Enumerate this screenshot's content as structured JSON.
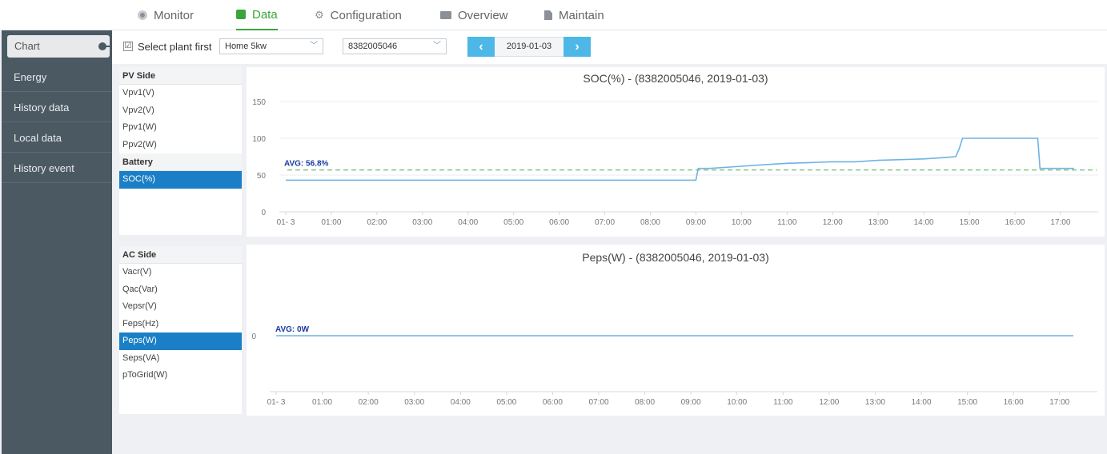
{
  "nav": {
    "tabs": [
      {
        "label": "Monitor",
        "icon": "monitor-icon"
      },
      {
        "label": "Data",
        "icon": "data-icon",
        "active": true
      },
      {
        "label": "Configuration",
        "icon": "configuration-icon"
      },
      {
        "label": "Overview",
        "icon": "overview-icon"
      },
      {
        "label": "Maintain",
        "icon": "maintain-icon"
      }
    ]
  },
  "sidebar": {
    "chart_label": "Chart",
    "items": [
      {
        "label": "Energy"
      },
      {
        "label": "History data"
      },
      {
        "label": "Local data"
      },
      {
        "label": "History event"
      }
    ]
  },
  "toolbar": {
    "checkbox_mark": "☑",
    "select_plant_label": "Select plant first",
    "plant_select": "Home 5kw",
    "device_select": "8382005046",
    "date": "2019-01-03",
    "prev_icon": "chevron-left-icon",
    "next_icon": "chevron-right-icon"
  },
  "pv_list": {
    "header": "PV Side",
    "items": [
      "Vpv1(V)",
      "Vpv2(V)",
      "Ppv1(W)",
      "Ppv2(W)"
    ],
    "battery_header": "Battery",
    "battery_items": [
      "SOC(%)"
    ],
    "selected": "SOC(%)"
  },
  "ac_list": {
    "header": "AC Side",
    "items": [
      "Vacr(V)",
      "Qac(Var)",
      "Vepsr(V)",
      "Feps(Hz)",
      "Peps(W)",
      "Seps(VA)",
      "pToGrid(W)"
    ],
    "selected": "Peps(W)"
  },
  "colors": {
    "accent": "#3aa53a",
    "sidebar": "#4b5963",
    "selected": "#1a7fc6",
    "line": "#6fb3e4",
    "avg_line": "#4caf50"
  },
  "chart_data": [
    {
      "type": "line",
      "title": "SOC(%) - (8382005046, 2019-01-03)",
      "x_labels": [
        "01- 3",
        "01:00",
        "02:00",
        "03:00",
        "04:00",
        "05:00",
        "06:00",
        "07:00",
        "08:00",
        "09:00",
        "10:00",
        "11:00",
        "12:00",
        "13:00",
        "14:00",
        "15:00",
        "16:00",
        "17:00"
      ],
      "y_ticks": [
        0,
        50,
        100,
        150
      ],
      "ylim": [
        0,
        150
      ],
      "grid": true,
      "avg_label": "AVG: 56.8%",
      "avg_value": 56.8,
      "series": [
        {
          "x": [
            0,
            9.0,
            9.05,
            9.3,
            10.0,
            10.5,
            11.0,
            11.5,
            12.0,
            12.5,
            13.0,
            13.5,
            14.0,
            14.5,
            14.7,
            14.78,
            14.85,
            15.5,
            16.0,
            16.5,
            16.55,
            17.3
          ],
          "y": [
            43,
            43,
            59,
            59,
            62,
            64,
            66,
            67,
            68,
            68,
            70,
            71,
            72,
            74,
            75,
            86,
            100,
            100,
            100,
            100,
            59,
            59
          ]
        }
      ]
    },
    {
      "type": "line",
      "title": "Peps(W) - (8382005046, 2019-01-03)",
      "x_labels": [
        "01- 3",
        "01:00",
        "02:00",
        "03:00",
        "04:00",
        "05:00",
        "06:00",
        "07:00",
        "08:00",
        "09:00",
        "10:00",
        "11:00",
        "12:00",
        "13:00",
        "14:00",
        "15:00",
        "16:00",
        "17:00"
      ],
      "y_ticks": [
        0
      ],
      "ylim": [
        -1,
        1
      ],
      "grid": false,
      "avg_label": "AVG: 0W",
      "avg_value": 0,
      "series": [
        {
          "x": [
            0,
            17.3
          ],
          "y": [
            0,
            0
          ]
        }
      ]
    }
  ]
}
